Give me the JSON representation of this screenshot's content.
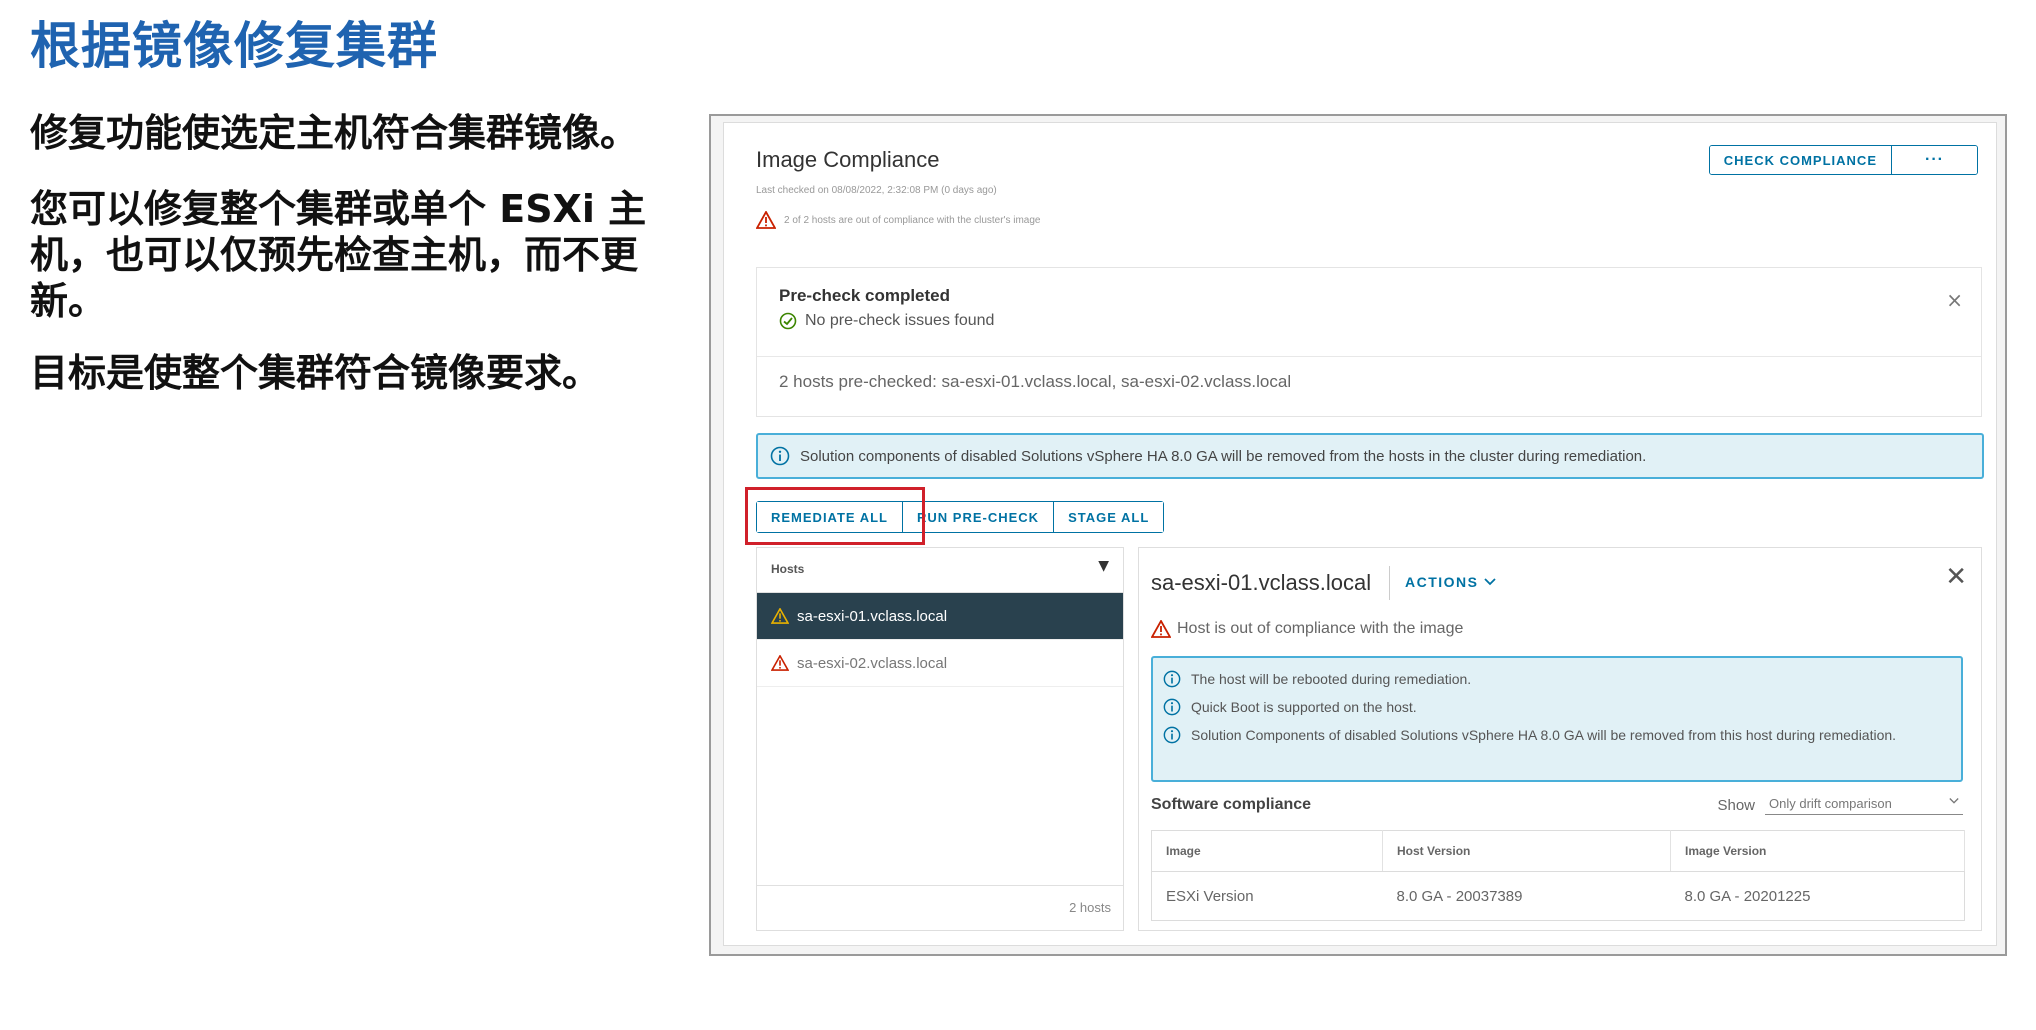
{
  "slide": {
    "title": "根据镜像修复集群",
    "paragraph1": "修复功能使选定主机符合集群镜像。",
    "paragraph2": "您可以修复整个集群或单个 ESXi 主机，也可以仅预先检查主机，而不更新。",
    "paragraph3": "目标是使整个集群符合镜像要求。"
  },
  "screen": {
    "title": "Image Compliance",
    "last_checked": "Last checked on 08/08/2022, 2:32:08 PM (0 days ago)",
    "out_of_compliance": "2 of 2 hosts are out of compliance with the cluster's image",
    "check_compliance_label": "CHECK COMPLIANCE",
    "more_label": "···",
    "precheck": {
      "heading": "Pre-check completed",
      "status": "No pre-check issues found",
      "close": "×",
      "hosts_line": "2 hosts pre-checked: sa-esxi-01.vclass.local, sa-esxi-02.vclass.local"
    },
    "banner": "Solution components of disabled Solutions vSphere HA 8.0 GA will be removed from the hosts in the cluster during remediation.",
    "actions": {
      "remediate_all": "REMEDIATE ALL",
      "run_precheck": "RUN PRE-CHECK",
      "stage_all": "STAGE ALL"
    },
    "hosts_panel": {
      "header": "Hosts",
      "filter_icon": "▼",
      "rows": [
        "sa-esxi-01.vclass.local",
        "sa-esxi-02.vclass.local"
      ],
      "footer": "2 hosts"
    },
    "detail": {
      "host": "sa-esxi-01.vclass.local",
      "actions_label": "ACTIONS",
      "close": "✕",
      "warning": "Host is out of compliance with the image",
      "info_lines": [
        "The host will be rebooted during remediation.",
        "Quick Boot is supported on the host.",
        "Solution Components of disabled Solutions vSphere HA 8.0 GA will be removed from this host during remediation."
      ],
      "software_compliance": "Software compliance",
      "show_label": "Show",
      "show_value": "Only drift comparison",
      "table": {
        "headers": [
          "Image",
          "Host Version",
          "Image Version"
        ],
        "rows": [
          [
            "ESXi Version",
            "8.0 GA - 20037389",
            "8.0 GA - 20201225"
          ]
        ]
      }
    }
  },
  "colors": {
    "title_blue": "#1f63b0",
    "action_blue": "#0072a3",
    "selected_row": "#29414e",
    "info_bg": "#e1f1f6",
    "info_border": "#49afd9",
    "highlight_red": "#d0202a",
    "warning_red": "#c92100",
    "warning_yellow": "#e8b100",
    "success_green": "#3c8500"
  },
  "icons": [
    "warning-triangle-icon",
    "success-check-icon",
    "info-circle-icon",
    "filter-icon",
    "chevron-down-icon",
    "close-icon"
  ]
}
